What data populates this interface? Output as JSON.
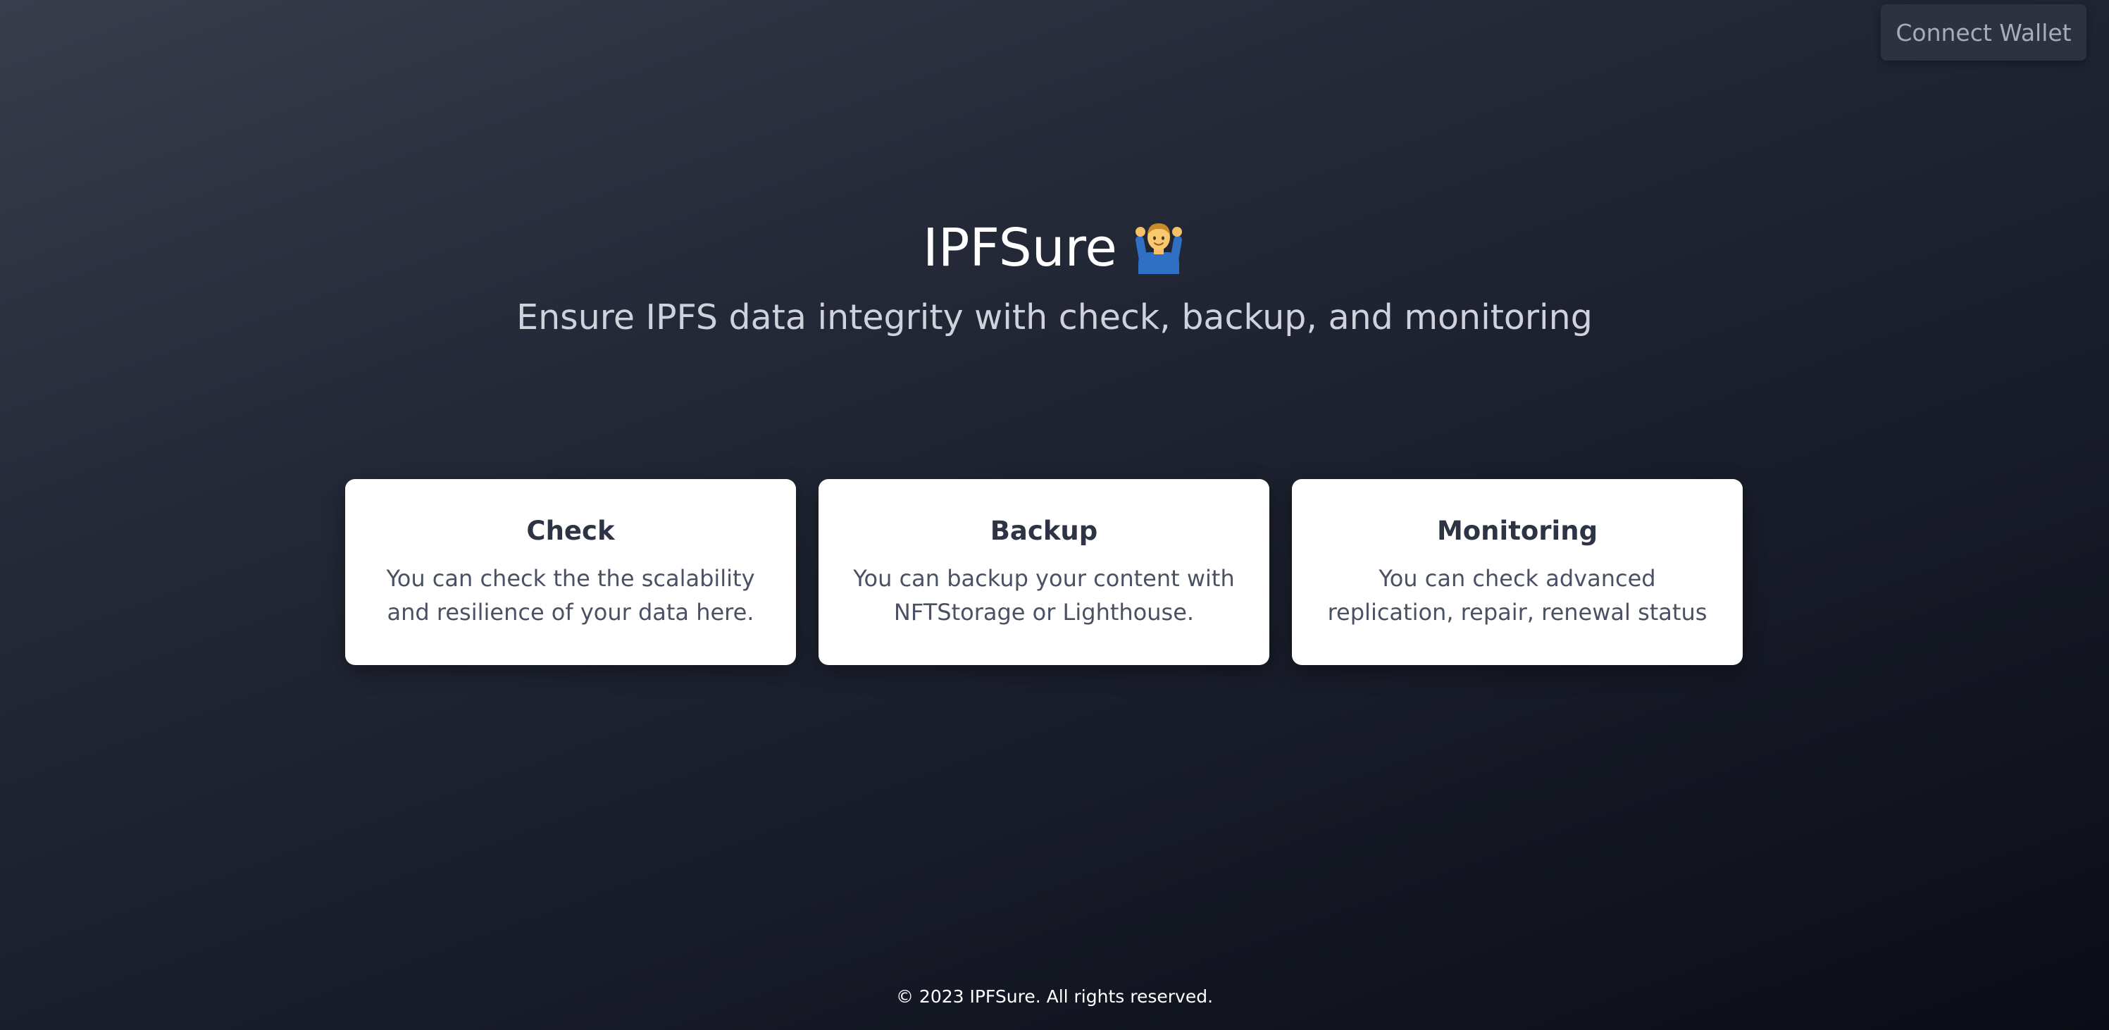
{
  "header": {
    "connect_wallet_label": "Connect Wallet"
  },
  "hero": {
    "title": "IPFSure",
    "title_icon": "person-gesturing-ok-icon",
    "subtitle": "Ensure IPFS data integrity with check, backup, and monitoring"
  },
  "cards": [
    {
      "title": "Check",
      "description": "You can check the the scalability and resilience of your data here."
    },
    {
      "title": "Backup",
      "description": "You can backup your content with NFTStorage or Lighthouse."
    },
    {
      "title": "Monitoring",
      "description": "You can check advanced replication, repair, renewal status"
    }
  ],
  "footer": {
    "copyright": "© 2023 IPFSure. All rights reserved."
  },
  "colors": {
    "background_top": "#383d4c",
    "background_bottom": "#0b0d16",
    "card_background": "#ffffff",
    "card_title": "#2d3445",
    "card_text": "#4a5163",
    "button_background": "#2d3240",
    "button_text": "#a6acba"
  }
}
